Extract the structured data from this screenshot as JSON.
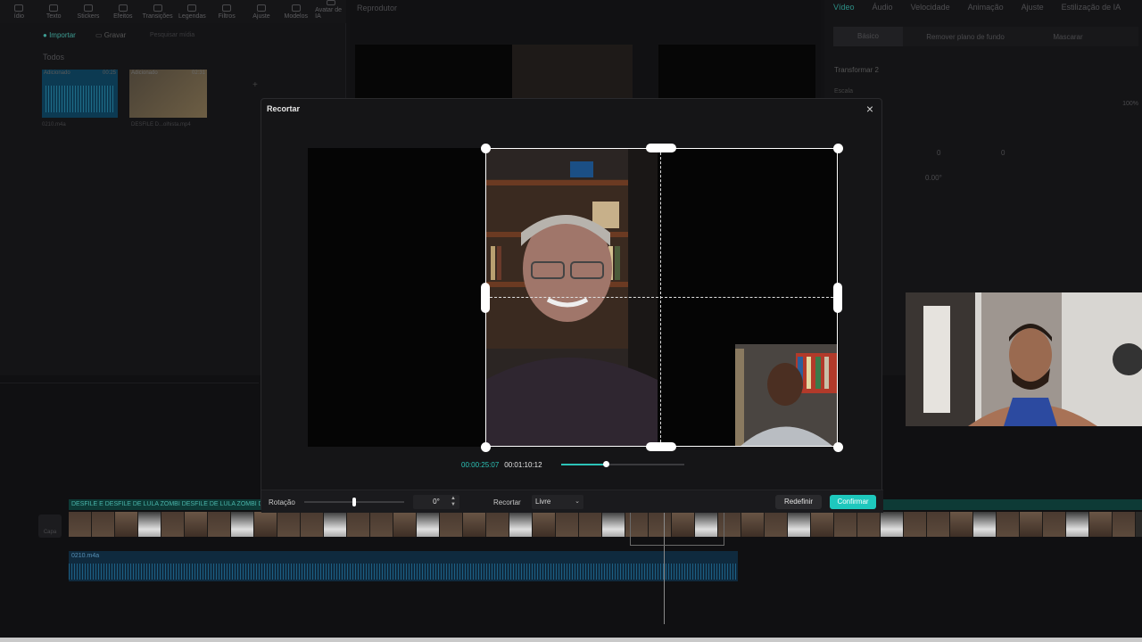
{
  "editor": {
    "toolbar": [
      "ídio",
      "Texto",
      "Stickers",
      "Efeitos",
      "Transições",
      "Legendas",
      "Filtros",
      "Ajuste",
      "Modelos",
      "Avatar de IA"
    ],
    "left": {
      "import_label": "Importar",
      "record_label": "Gravar",
      "search_placeholder": "Pesquisar mídia",
      "all_label": "Todos",
      "media": [
        {
          "badge": "Adicionado",
          "duration": "00:25",
          "name": "0210.m4a"
        },
        {
          "badge": "Adicionado",
          "duration": "02:31",
          "name": "DESFILE D...olhista.mp4"
        }
      ]
    },
    "player_title": "Reprodutor",
    "right": {
      "tabs": [
        "Vídeo",
        "Áudio",
        "Velocidade",
        "Animação",
        "Ajuste",
        "Estilização de IA"
      ],
      "subtabs": [
        "Básico",
        "Remover plano de fundo",
        "Mascarar"
      ],
      "transform_label": "Transformar 2",
      "scale_label": "Escala",
      "scale_value": "100%",
      "pos_x": "0",
      "pos_y": "0",
      "rotation": "0.00°"
    },
    "timeline": {
      "video_track_label": "DESFILE E   DESFILE DE LULA ZOMBI   DESFILE DE LULA ZOMBI   DESFILE DE LULA ZOMBI ... ZOMBA DOS EVANGÉLICOS E DE BOLSONARO - DAN   DESFILE DE LULA ZOMBI",
      "audio_track_label": "0210.m4a",
      "cover_label": "Capa"
    }
  },
  "crop_dialog": {
    "title": "Recortar",
    "current_time": "00:00:25:07",
    "total_time": "00:01:10:12",
    "seek_progress": 0.36,
    "rotation_label": "Rotação",
    "rotation_value": "0°",
    "rotation_slider": 0.5,
    "crop_label": "Recortar",
    "crop_ratio": "Livre",
    "reset_label": "Redefinir",
    "confirm_label": "Confirmar"
  },
  "colors": {
    "accent": "#1ec8bd",
    "background": "#121214",
    "dialog": "#151517"
  }
}
